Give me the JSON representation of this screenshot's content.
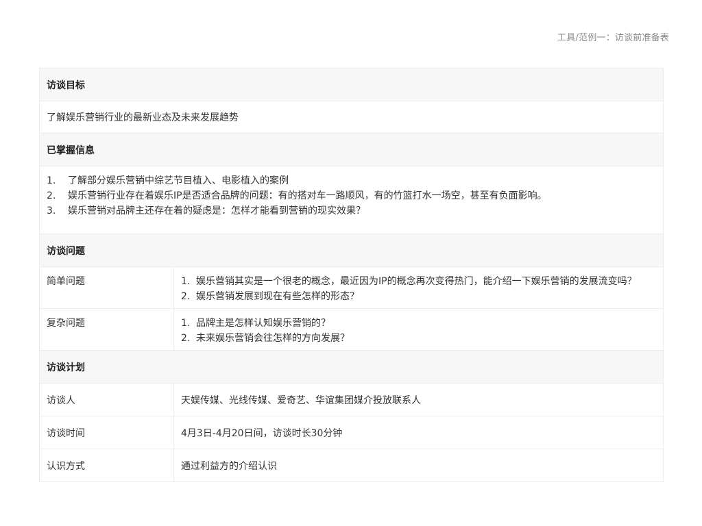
{
  "breadcrumb": "工具/范例一：访谈前准备表",
  "goal": {
    "title": "访谈目标",
    "text": "了解娱乐营销行业的最新业态及未来发展趋势"
  },
  "known": {
    "title": "已掌握信息",
    "items": [
      {
        "num": "1.",
        "text": "了解部分娱乐营销中综艺节目植入、电影植入的案例"
      },
      {
        "num": "2.",
        "text": "娱乐营销行业存在着娱乐IP是否适合品牌的问题：有的搭对车一路顺风，有的竹篮打水一场空，甚至有负面影响。"
      },
      {
        "num": "3.",
        "text": "娱乐营销对品牌主还存在着的疑虑是：怎样才能看到营销的现实效果？"
      }
    ]
  },
  "questions": {
    "title": "访谈问题",
    "simple": {
      "label": "简单问题",
      "items": [
        {
          "num": "1.",
          "text": "娱乐营销其实是一个很老的概念，最近因为IP的概念再次变得热门，能介绍一下娱乐营销的发展流变吗？"
        },
        {
          "num": "2.",
          "text": "娱乐营销发展到现在有些怎样的形态？"
        }
      ]
    },
    "complex": {
      "label": "复杂问题",
      "items": [
        {
          "num": "1.",
          "text": "品牌主是怎样认知娱乐营销的？"
        },
        {
          "num": "2.",
          "text": "未来娱乐营销会往怎样的方向发展？"
        }
      ]
    }
  },
  "plan": {
    "title": "访谈计划",
    "rows": [
      {
        "label": "访谈人",
        "value": "天娱传媒、光线传媒、爱奇艺、华谊集团媒介投放联系人"
      },
      {
        "label": "访谈时间",
        "value": "4月3日-4月20日间，访谈时长30分钟"
      },
      {
        "label": "认识方式",
        "value": "通过利益方的介绍认识"
      }
    ]
  }
}
